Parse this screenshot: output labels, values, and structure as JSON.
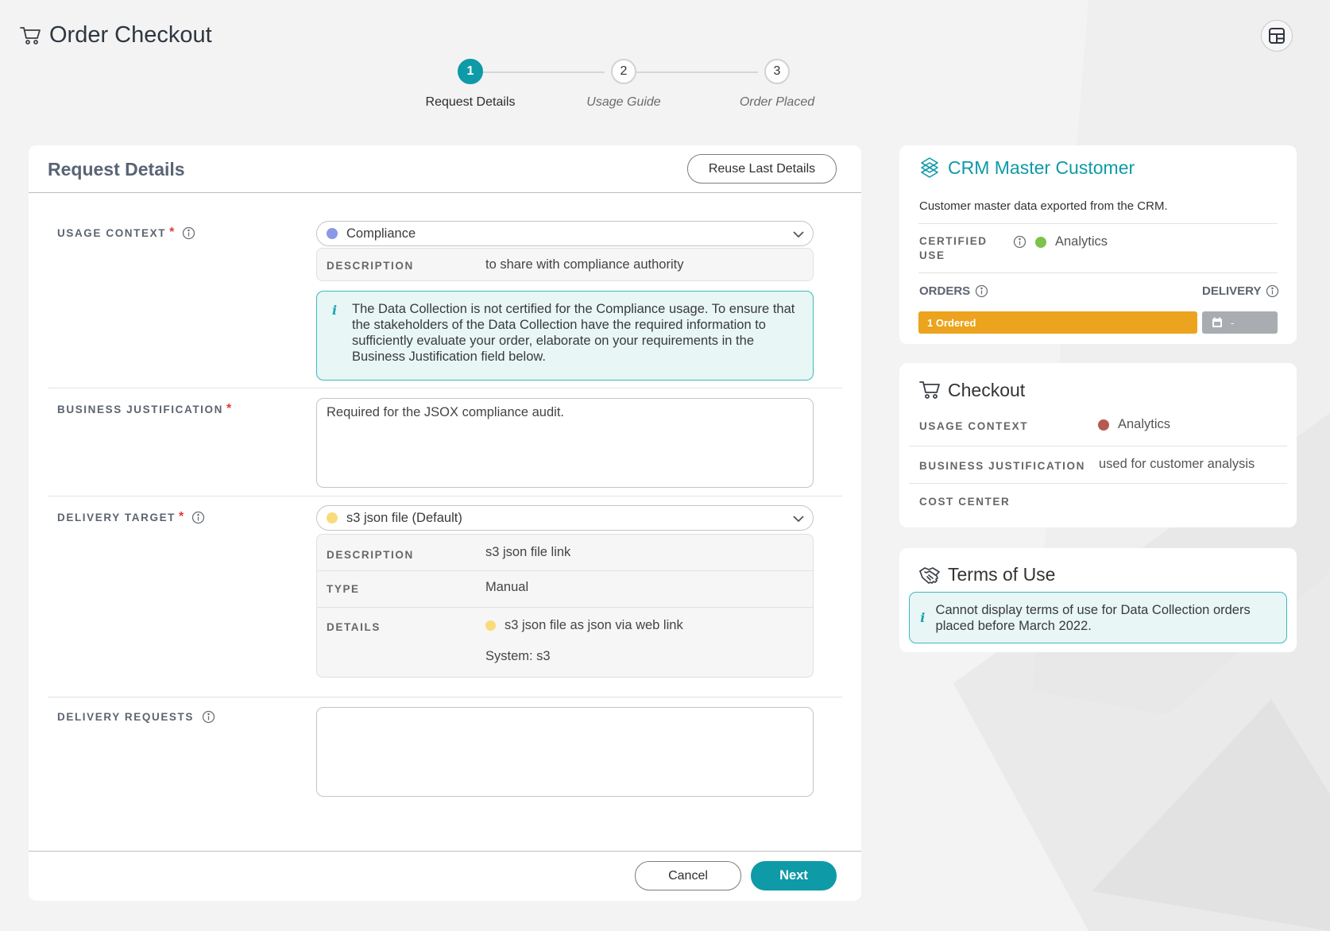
{
  "app": {
    "title": "Order Checkout",
    "cart_icon": "cart-icon",
    "layout_icon": "layout-icon"
  },
  "stepper": {
    "steps": [
      {
        "number": "1",
        "label": "Request Details",
        "active": true
      },
      {
        "number": "2",
        "label": "Usage Guide",
        "active": false
      },
      {
        "number": "3",
        "label": "Order Placed",
        "active": false
      }
    ]
  },
  "colors": {
    "accent": "#0e9aa7",
    "required": "#e03b3b",
    "compliance_dot": "#8b98e6",
    "s3_dot": "#f8dc7a",
    "certified_dot": "#7cc24b",
    "analytics_dot": "#b55a4f",
    "ordered_bar": "#eca31d",
    "delivery_bar": "#a9adb2"
  },
  "request": {
    "title": "Request Details",
    "reuse_label": "Reuse Last Details",
    "usage_context": {
      "label": "USAGE CONTEXT",
      "required": "*",
      "value": "Compliance",
      "description_key": "DESCRIPTION",
      "description": "to share with compliance authority",
      "notice": "The Data Collection is not certified for the Compliance usage. To ensure that the stakeholders of the Data Collection have the required information to sufficiently evaluate your order, elaborate on your requirements in the Business Justification field below."
    },
    "business_justification": {
      "label": "BUSINESS JUSTIFICATION",
      "required": "*",
      "value": "Required for the JSOX compliance audit."
    },
    "delivery_target": {
      "label": "DELIVERY TARGET",
      "required": "*",
      "value": "s3 json file (Default)",
      "rows": {
        "description_key": "DESCRIPTION",
        "description": "s3 json file link",
        "type_key": "TYPE",
        "type": "Manual",
        "details_key": "DETAILS",
        "details_line1": "s3 json file as json via web link",
        "details_line2": "System: s3"
      }
    },
    "delivery_requests": {
      "label": "DELIVERY REQUESTS",
      "value": ""
    },
    "cancel_label": "Cancel",
    "next_label": "Next"
  },
  "crm": {
    "title": "CRM Master Customer",
    "description": "Customer master data exported from the CRM.",
    "certified_use_key_1": "CERTIFIED",
    "certified_use_key_2": "USE",
    "certified_use_value": "Analytics",
    "orders_label": "ORDERS",
    "delivery_label": "DELIVERY",
    "ordered_text": "1 Ordered",
    "delivery_text": "-"
  },
  "checkout": {
    "title": "Checkout",
    "usage_context_key": "USAGE CONTEXT",
    "usage_context_value": "Analytics",
    "business_justification_key": "BUSINESS JUSTIFICATION",
    "business_justification_value": "used for customer analysis",
    "cost_center_key": "COST CENTER"
  },
  "terms": {
    "title": "Terms of Use",
    "notice": "Cannot display terms of use for Data Collection orders placed before March 2022."
  }
}
